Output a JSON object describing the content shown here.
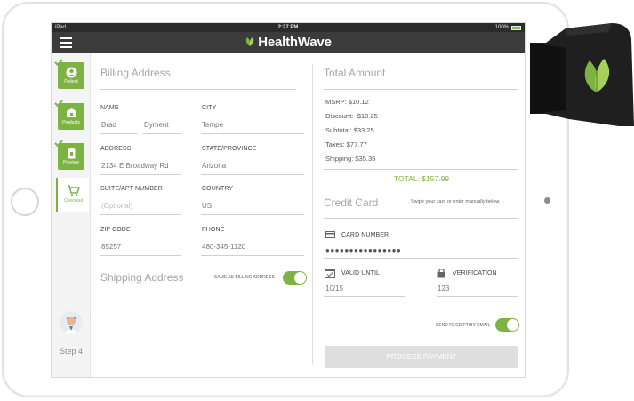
{
  "status_bar": {
    "device": "iPad",
    "time": "2:27 PM",
    "battery": "100%",
    "battery_level": 1.0
  },
  "app": {
    "brand": "HealthWave",
    "brand_color": "#7cb342"
  },
  "sidebar": {
    "steps": [
      {
        "label": "Patient",
        "icon": "person-icon",
        "completed": true
      },
      {
        "label": "Products",
        "icon": "box-icon",
        "completed": true
      },
      {
        "label": "Preview",
        "icon": "clipboard-icon",
        "completed": true
      },
      {
        "label": "Checkout",
        "icon": "cart-icon",
        "active": true
      }
    ],
    "step_indicator": "Step 4"
  },
  "billing": {
    "title": "Billing Address",
    "name": {
      "label": "NAME",
      "first": "Brad",
      "last": "Dyment"
    },
    "city": {
      "label": "CITY",
      "value": "Tempe"
    },
    "address": {
      "label": "ADDRESS",
      "value": "2134 E Broadway Rd"
    },
    "state": {
      "label": "STATE/PROVINCE",
      "value": "Arizona"
    },
    "suite": {
      "label": "SUITE/APT NUMBER",
      "placeholder": "(Optional)"
    },
    "country": {
      "label": "COUNTRY",
      "value": "US"
    },
    "zip": {
      "label": "ZIP CODE",
      "value": "85257"
    },
    "phone": {
      "label": "PHONE",
      "value": "480-345-1120"
    }
  },
  "shipping": {
    "title": "Shipping Address",
    "same_as_billing_label": "SAME AS BILLING ADDRESS",
    "same_as_billing": true
  },
  "total_amount": {
    "title": "Total Amount",
    "lines": [
      "MSRP: $10.12",
      "Discount: -$10.25",
      "Subtotal: $33.25",
      "Taxes: $77.77",
      "Shipping: $35.35"
    ],
    "total": "TOTAL: $157.99"
  },
  "credit_card": {
    "title": "Credit Card",
    "hint": "Swipe your card or enter manually below.",
    "card_number": {
      "label": "CARD NUMBER",
      "value": "●●●●●●●●●●●●●●●●"
    },
    "valid_until": {
      "label": "VALID UNTIL",
      "value": "10/15"
    },
    "verification": {
      "label": "VERIFICATION",
      "value": "123"
    },
    "receipt_label": "SEND RECEIPT BY EMAIL",
    "send_receipt": true,
    "button": "PROCESS PAYMENT"
  }
}
